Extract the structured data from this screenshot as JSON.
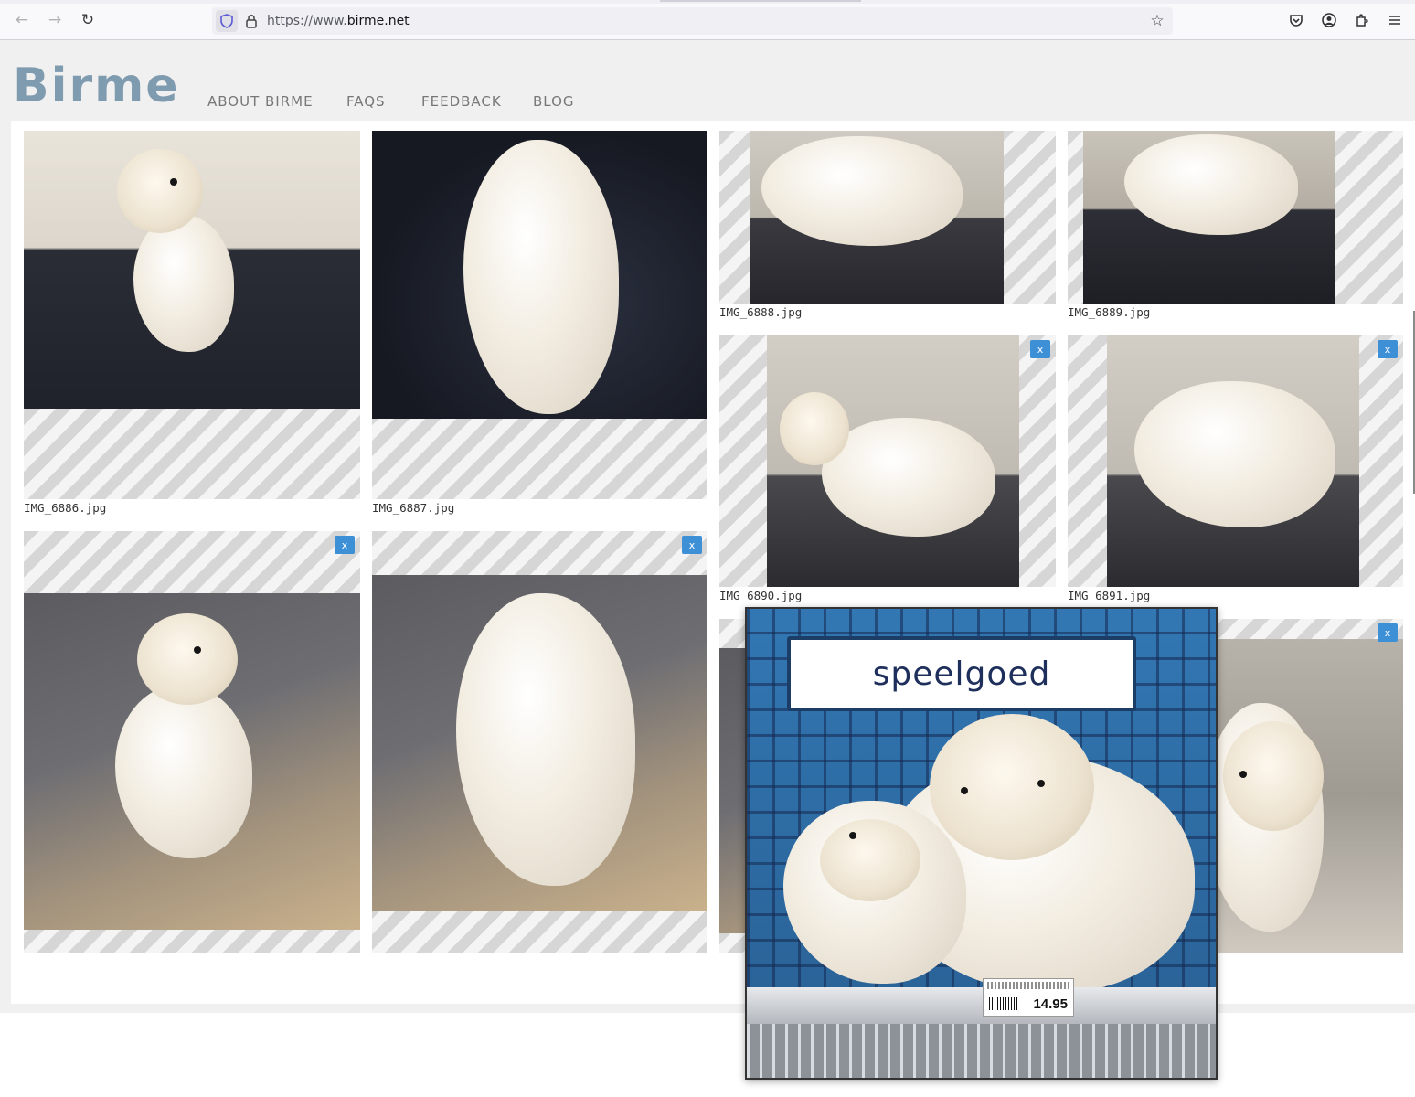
{
  "browser": {
    "url_prefix": "https://www.",
    "url_host": "birme.net",
    "back_icon": "arrow-left-icon",
    "forward_icon": "arrow-right-icon",
    "reload_icon": "reload-icon",
    "bookmark_icon": "star-icon"
  },
  "site": {
    "logo": "Birme",
    "menu": [
      "ABOUT BIRME",
      "FAQS",
      "FEEDBACK",
      "BLOG"
    ]
  },
  "gallery": {
    "remove_label": "x",
    "captions": {
      "img_6886": "IMG_6886.jpg",
      "img_6887": "IMG_6887.jpg",
      "img_6888": "IMG_6888.jpg",
      "img_6889": "IMG_6889.jpg",
      "img_6890": "IMG_6890.jpg",
      "img_6891": "IMG_6891.jpg"
    }
  },
  "preview": {
    "sign_text": "speelgoed",
    "price": "14.95"
  },
  "colors": {
    "logo": "#7f9bb0",
    "remove_button": "#3d8fd6",
    "menu_text": "#777777"
  }
}
